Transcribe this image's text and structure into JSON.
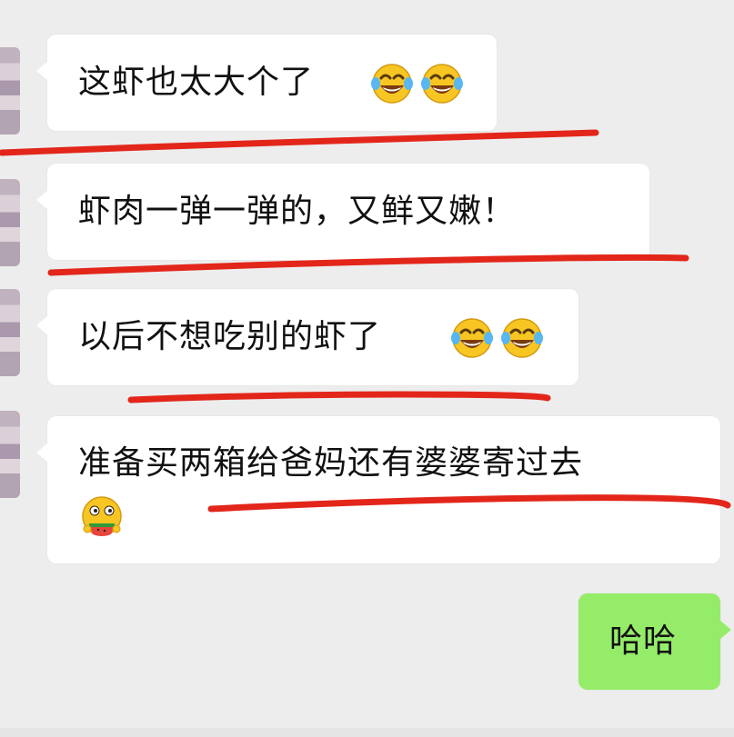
{
  "chat": {
    "messages": [
      {
        "sender": "other",
        "text": "这虾也太大个了",
        "emojis": [
          "tears-of-joy",
          "tears-of-joy"
        ]
      },
      {
        "sender": "other",
        "text": "虾肉一弹一弹的，又鲜又嫩！",
        "emojis": []
      },
      {
        "sender": "other",
        "text": "以后不想吃别的虾了",
        "emojis": [
          "tears-of-joy",
          "tears-of-joy"
        ]
      },
      {
        "sender": "other",
        "text": "准备买两箱给爸妈还有婆婆寄过去",
        "emojis": [
          "eating-watermelon"
        ]
      },
      {
        "sender": "self",
        "text": "哈哈",
        "emojis": []
      }
    ]
  },
  "colors": {
    "chat_background": "#ededed",
    "received_bubble": "#ffffff",
    "sent_bubble": "#95ec69",
    "highlight_underline": "#e3261a"
  }
}
